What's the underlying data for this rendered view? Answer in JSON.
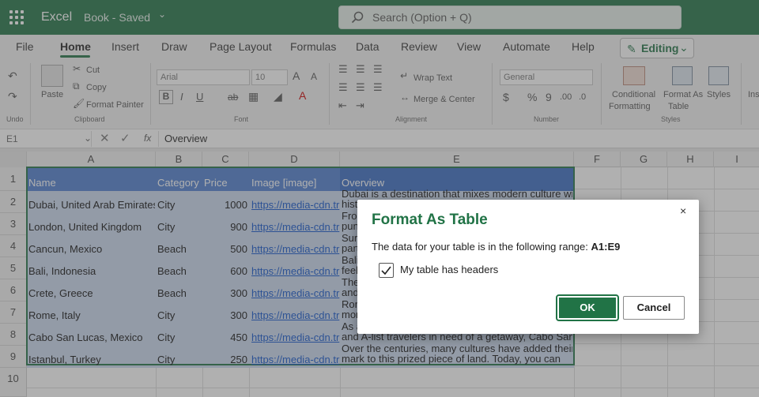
{
  "titlebar": {
    "app": "Excel",
    "book": "Book  -  Saved",
    "search_placeholder": "Search (Option + Q)",
    "color": "#217346"
  },
  "tabs": [
    "File",
    "Home",
    "Insert",
    "Draw",
    "Page Layout",
    "Formulas",
    "Data",
    "Review",
    "View",
    "Automate",
    "Help"
  ],
  "active_tab": "Home",
  "mode_button": "Editing",
  "ribbon": {
    "undo_group": "Undo",
    "clipboard": {
      "paste": "Paste",
      "cut": "Cut",
      "copy": "Copy",
      "format_painter": "Format Painter",
      "group": "Clipboard"
    },
    "font": {
      "name": "Arial",
      "size": "10",
      "grow": "A",
      "shrink": "A",
      "bold": "B",
      "italic": "I",
      "underline": "U",
      "strike": "ab",
      "group": "Font"
    },
    "alignment": {
      "wrap": "Wrap Text",
      "merge": "Merge & Center",
      "group": "Alignment"
    },
    "number": {
      "format": "General",
      "currency": "$",
      "percent": "%",
      "comma": "9",
      "inc_dec": ".00",
      "dec_dec": ".0",
      "group": "Number"
    },
    "styles": {
      "conditional": "Conditional",
      "conditional2": "Formatting",
      "format_as": "Format As",
      "table": "Table",
      "styles": "Styles",
      "group": "Styles"
    },
    "insert_cut": "Ins"
  },
  "formula_bar": {
    "cell_ref": "E1",
    "fx": "fx",
    "content": "Overview"
  },
  "columns": [
    "A",
    "B",
    "C",
    "D",
    "E",
    "F",
    "G",
    "H",
    "I"
  ],
  "rows": [
    "1",
    "2",
    "3",
    "4",
    "5",
    "6",
    "7",
    "8",
    "9",
    "10"
  ],
  "table": {
    "headers": [
      "Name",
      "Category",
      "Price",
      "Image [image]",
      "Overview"
    ],
    "rows": [
      {
        "name": "Dubai, United Arab Emirates",
        "category": "City",
        "price": "1000",
        "image": "https://media-cdn.tr",
        "overview1": "Dubai is a destination that mixes modern culture with",
        "overview2": "hist"
      },
      {
        "name": "London, United Kingdom",
        "category": "City",
        "price": "900",
        "image": "https://media-cdn.tr",
        "overview1": "Fro",
        "overview2": "pun"
      },
      {
        "name": "Cancun, Mexico",
        "category": "Beach",
        "price": "500",
        "image": "https://media-cdn.tr",
        "overview1": "Sur",
        "overview2": "part"
      },
      {
        "name": "Bali, Indonesia",
        "category": "Beach",
        "price": "600",
        "image": "https://media-cdn.tr",
        "overview1": "Bali",
        "overview2": "feel"
      },
      {
        "name": "Crete, Greece",
        "category": "Beach",
        "price": "300",
        "image": "https://media-cdn.tr",
        "overview1": "The",
        "overview2": "and"
      },
      {
        "name": "Rome, Italy",
        "category": "City",
        "price": "300",
        "image": "https://media-cdn.tr",
        "overview1": "Ron",
        "overview2": "mor"
      },
      {
        "name": "Cabo San Lucas, Mexico",
        "category": "City",
        "price": "450",
        "image": "https://media-cdn.tr",
        "overview1": "As a",
        "overview2": "and A-list travelers in need of a getaway, Cabo San"
      },
      {
        "name": "Istanbul, Turkey",
        "category": "City",
        "price": "250",
        "image": "https://media-cdn.tr",
        "overview1": "Over the centuries, many cultures have added their",
        "overview2": "mark to this prized piece of land. Today, you can"
      }
    ]
  },
  "dialog": {
    "title": "Format As Table",
    "close": "×",
    "text": "The data for your table is in the following range:",
    "range": "A1:E9",
    "checkbox_label": "My table has headers",
    "checked": true,
    "ok": "OK",
    "cancel": "Cancel"
  }
}
